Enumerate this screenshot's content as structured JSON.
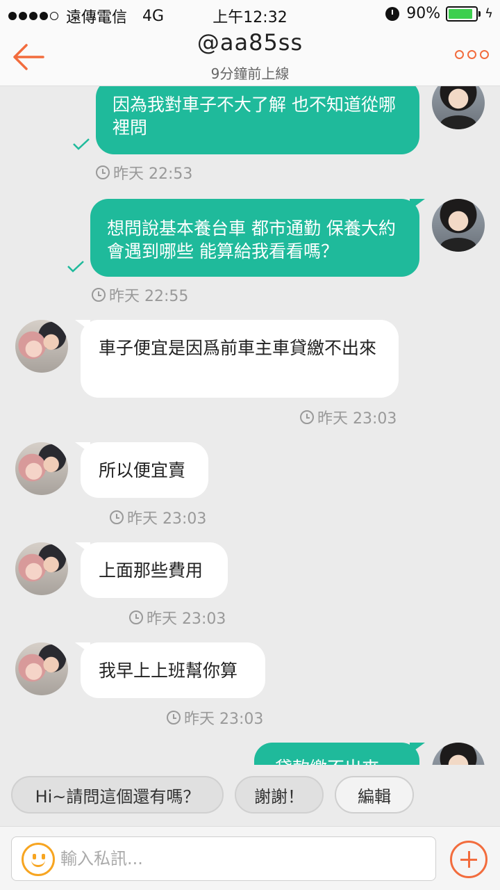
{
  "status_bar": {
    "carrier": "遠傳電信",
    "network": "4G",
    "time": "上午12:32",
    "battery": "90%",
    "battery_level": 0.9
  },
  "header": {
    "title": "@aa85ss",
    "subtitle": "9分鐘前上線"
  },
  "messages": [
    {
      "direction": "out",
      "text": "因為我對車子不大了解 也不知道從哪裡問",
      "time": "昨天 22:53",
      "read": true
    },
    {
      "direction": "out",
      "text": "想問說基本養台車 都市通勤 保養大約會遇到哪些 能算給我看看嗎？",
      "time": "昨天 22:55",
      "read": true
    },
    {
      "direction": "in",
      "text": "車子便宜是因爲前車主車貸繳不出來",
      "time": "昨天 23:03"
    },
    {
      "direction": "in",
      "text": "所以便宜賣",
      "time": "昨天 23:03"
    },
    {
      "direction": "in",
      "text": "上面那些費用",
      "time": "昨天 23:03"
    },
    {
      "direction": "in",
      "text": "我早上上班幫你算",
      "time": "昨天 23:03"
    },
    {
      "direction": "out",
      "text": "貸款繳不出來…",
      "time": ""
    }
  ],
  "quick_replies": [
    "Hi~請問這個還有嗎？",
    "謝謝！",
    "編輯"
  ],
  "input": {
    "placeholder": "輸入私訊..."
  },
  "colors": {
    "accent": "#f26c3d",
    "outgoing_bubble": "#1fba9b",
    "incoming_bubble": "#ffffff",
    "background": "#ebebeb"
  },
  "icons": {
    "back": "back-arrow-icon",
    "more": "more-dots-icon",
    "emoji": "smiley-icon",
    "add": "plus-circle-icon",
    "read": "checkmark-icon",
    "time": "clock-icon"
  }
}
